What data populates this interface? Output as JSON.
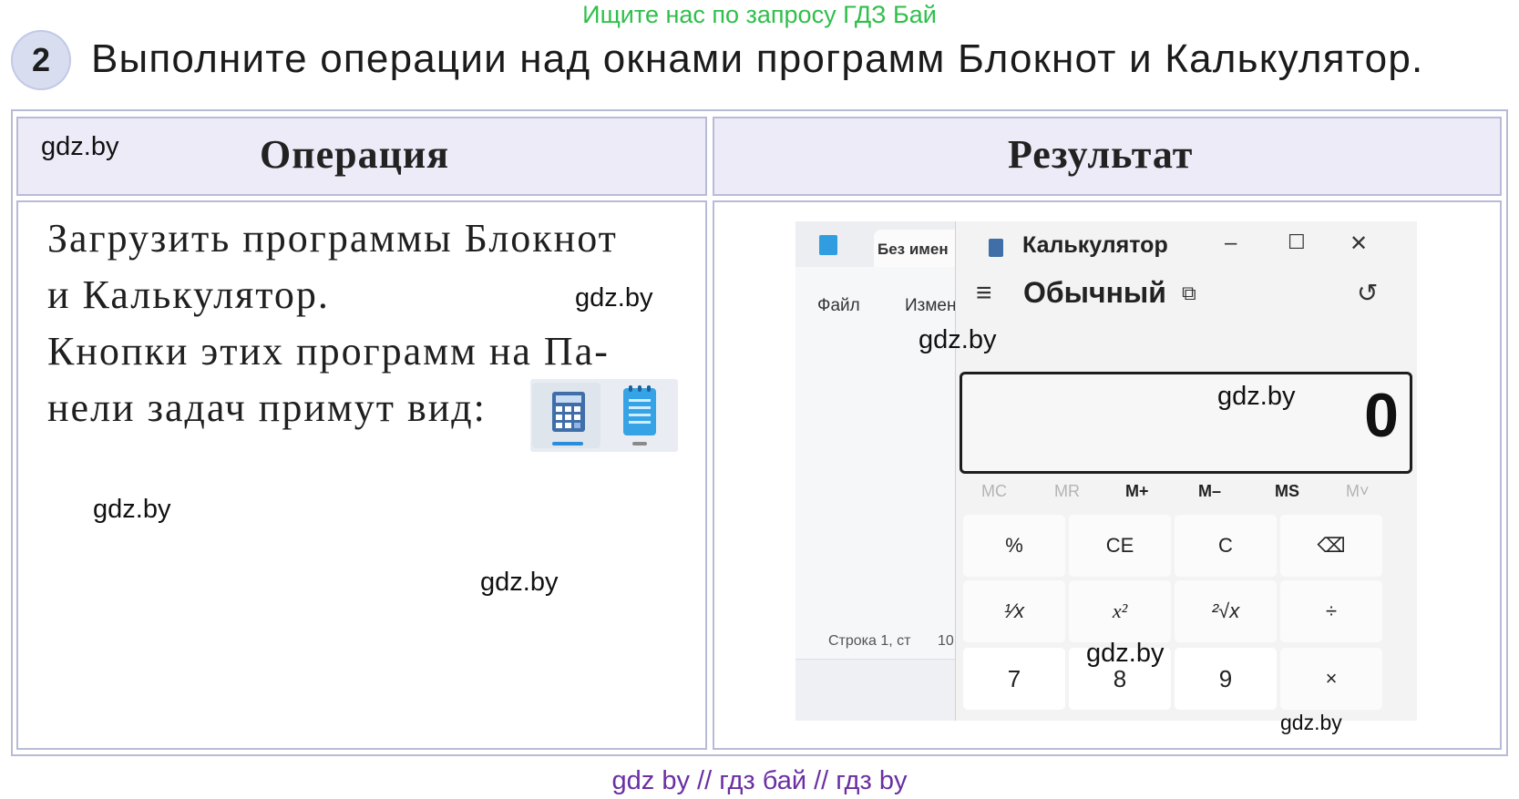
{
  "top_note": "Ищите нас по запросу ГДЗ Бай",
  "task": {
    "number": "2",
    "text": "Выполните операции над окнами программ Блокнот и Калькулятор."
  },
  "table": {
    "headers": {
      "operation": "Операция",
      "result": "Результат"
    },
    "operation_lines": [
      "Загрузить программы Блокнот",
      "и Калькулятор.",
      "Кнопки этих программ на Па-",
      "нели задач примут вид:"
    ]
  },
  "watermark": "gdz.by",
  "taskbar_icons": [
    "calculator-icon",
    "notepad-icon"
  ],
  "screenshot": {
    "notepad": {
      "title": "Без имен",
      "menu": [
        "Файл",
        "Измен"
      ],
      "status": "Строка 1, ст",
      "status_tail": "10"
    },
    "calculator": {
      "title": "Калькулятор",
      "window_controls": [
        "–",
        "☐",
        "✕"
      ],
      "menu_icon": "≡",
      "mode": "Обычный",
      "keep_on_top_icon": "⧉",
      "history_icon": "↺",
      "display": "0",
      "memory": [
        "MC",
        "MR",
        "M+",
        "M–",
        "MS",
        "M˅"
      ],
      "keys": [
        [
          "%",
          "CE",
          "C",
          "⌫"
        ],
        [
          "¹⁄x",
          "x²",
          "²√x",
          "÷"
        ],
        [
          "7",
          "8",
          "9",
          "×"
        ]
      ]
    }
  },
  "bottom_links": "gdz by  //  гдз бай  //  гдз by",
  "colors": {
    "top_note": "#2fbf4a",
    "table_border": "#b7bbd7",
    "header_bg": "#ecebf7",
    "bottom_links": "#6a2fa3"
  }
}
